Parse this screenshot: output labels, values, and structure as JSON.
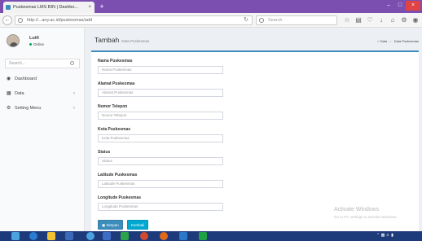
{
  "browser": {
    "tab_title": "Puskesmas LMS BIN | Dashbo...",
    "tab_close": "×",
    "new_tab": "+",
    "url": "http://...any.ac.id/puskesmas/add",
    "search_placeholder": "Search",
    "window_controls": {
      "minimize": "–",
      "maximize": "□",
      "close": "×"
    }
  },
  "sidebar": {
    "user_name": "Lutfi",
    "user_status": "Online",
    "search_placeholder": "Search...",
    "items": [
      {
        "label": "Dashboard",
        "icon": "dashboard-icon",
        "has_children": false
      },
      {
        "label": "Data",
        "icon": "table-icon",
        "has_children": true
      },
      {
        "label": "Setting Menu",
        "icon": "cogs-icon",
        "has_children": true
      }
    ]
  },
  "header": {
    "title": "Tambah",
    "subtitle": "Data Puskesmas",
    "breadcrumb": [
      "Data",
      "Data Puskesmas"
    ]
  },
  "form": {
    "fields": [
      {
        "label": "Nama Puskesmas",
        "placeholder": "Nama Puskesmas"
      },
      {
        "label": "Alamat Puskesmas",
        "placeholder": "Alamat Puskesmas"
      },
      {
        "label": "Nomor Telepon",
        "placeholder": "Nomor Telepon"
      },
      {
        "label": "Kota Puskesmas",
        "placeholder": "Kota Puskesmas"
      },
      {
        "label": "Status",
        "placeholder": "Status"
      },
      {
        "label": "Latitude Puskesmas",
        "placeholder": "Latitude Puskesmas"
      },
      {
        "label": "Longitude Puskesmas",
        "placeholder": "Longitude Puskesmas"
      }
    ],
    "save_label": "Simpan",
    "back_label": "Kembali"
  },
  "watermark": {
    "title": "Activate Windows",
    "subtitle": "Go to PC settings to activate Windows."
  },
  "colors": {
    "titlebar": "#7a4fb0",
    "primary": "#3c8dbc",
    "info": "#00a7d0",
    "taskbar": "#1d3a7a"
  }
}
